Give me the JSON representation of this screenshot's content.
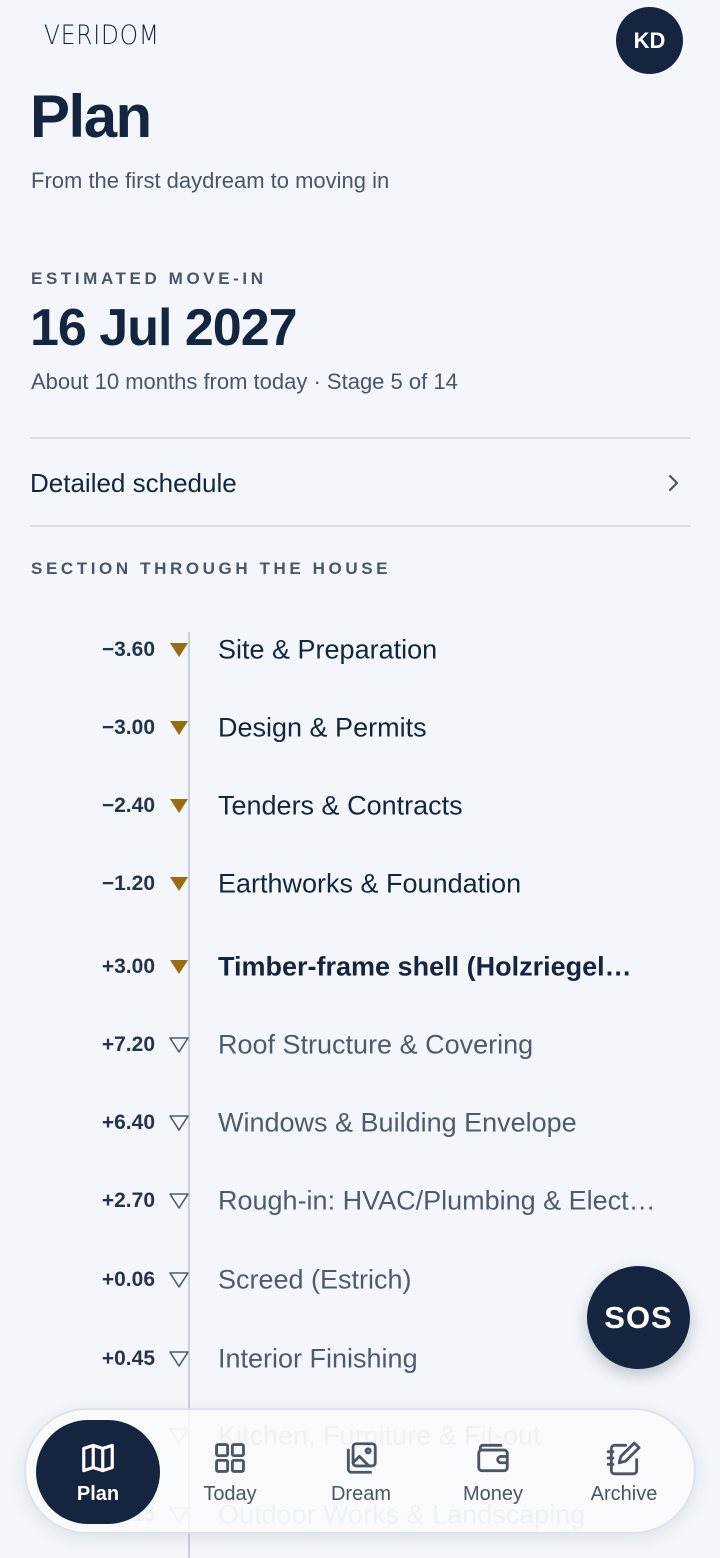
{
  "header": {
    "brand": "VERIDOM",
    "avatar_initials": "KD",
    "title": "Plan",
    "subtitle": "From the first daydream to moving in"
  },
  "movein": {
    "eyebrow": "ESTIMATED MOVE-IN",
    "date": "16 Jul 2027",
    "meta": "About 10 months from today · Stage 5 of 14"
  },
  "schedule": {
    "label": "Detailed schedule"
  },
  "section": {
    "eyebrow": "SECTION THROUGH THE HOUSE",
    "stages": [
      {
        "level": "−3.60",
        "title": "Site & Preparation",
        "status": "done"
      },
      {
        "level": "−3.00",
        "title": "Design & Permits",
        "status": "done"
      },
      {
        "level": "−2.40",
        "title": "Tenders & Contracts",
        "status": "done"
      },
      {
        "level": "−1.20",
        "title": "Earthworks & Foundation",
        "status": "done"
      },
      {
        "level": "+3.00",
        "title": "Timber-frame shell (Holzriegel…",
        "status": "current"
      },
      {
        "level": "+7.20",
        "title": "Roof Structure & Covering",
        "status": "pending"
      },
      {
        "level": "+6.40",
        "title": "Windows & Building Envelope",
        "status": "pending"
      },
      {
        "level": "+2.70",
        "title": "Rough-in: HVAC/Plumbing & Elect…",
        "status": "pending"
      },
      {
        "level": "+0.06",
        "title": "Screed (Estrich)",
        "status": "pending"
      },
      {
        "level": "+0.45",
        "title": "Interior Finishing",
        "status": "pending"
      },
      {
        "level": "",
        "title": "Kitchen, Furniture & Fit-out",
        "status": "faded"
      },
      {
        "level": "+0.15",
        "title": "Outdoor Works & Landscaping",
        "status": "faded"
      }
    ]
  },
  "sos_label": "SOS",
  "tabs": [
    {
      "label": "Plan",
      "icon": "map-icon",
      "active": true
    },
    {
      "label": "Today",
      "icon": "grid-icon",
      "active": false
    },
    {
      "label": "Dream",
      "icon": "images-icon",
      "active": false
    },
    {
      "label": "Money",
      "icon": "wallet-icon",
      "active": false
    },
    {
      "label": "Archive",
      "icon": "notebook-pen-icon",
      "active": false
    }
  ],
  "colors": {
    "navy": "#15253f",
    "accent_gold": "#9a6c10",
    "background": "#f3f7fb",
    "muted_text": "#4a5566"
  }
}
